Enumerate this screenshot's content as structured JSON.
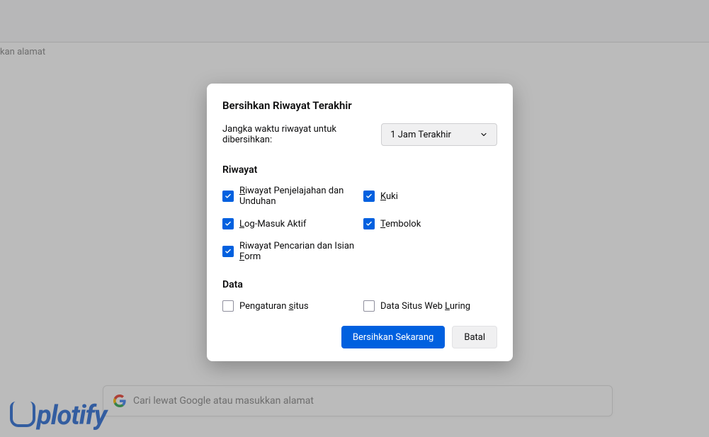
{
  "background": {
    "address_placeholder": "kan alamat",
    "search_placeholder": "Cari lewat Google atau masukkan alamat",
    "watermark": "plotify"
  },
  "dialog": {
    "title": "Bersihkan Riwayat Terakhir",
    "range_label": "Jangka waktu riwayat untuk dibersihkan:",
    "range_value": "1 Jam Terakhir",
    "section_history": "Riwayat",
    "section_data": "Data",
    "checks": {
      "browsing": {
        "label": "Riwayat Penjelajahan dan Unduhan",
        "accel": "R",
        "checked": true
      },
      "cookies": {
        "label": "Kuki",
        "accel": "K",
        "checked": true
      },
      "logins": {
        "label": "Log-Masuk Aktif",
        "accel": "L",
        "checked": true
      },
      "cache": {
        "label": "Tembolok",
        "accel": "T",
        "checked": true
      },
      "forms": {
        "label": "Riwayat Pencarian dan Isian Form",
        "accel": "F",
        "checked": true
      },
      "site": {
        "label": "Pengaturan situs",
        "accel": "s",
        "checked": false
      },
      "offline": {
        "label": "Data Situs Web Luring",
        "accel": "L",
        "checked": false
      }
    },
    "btn_clear": "Bersihkan Sekarang",
    "btn_cancel": "Batal"
  }
}
